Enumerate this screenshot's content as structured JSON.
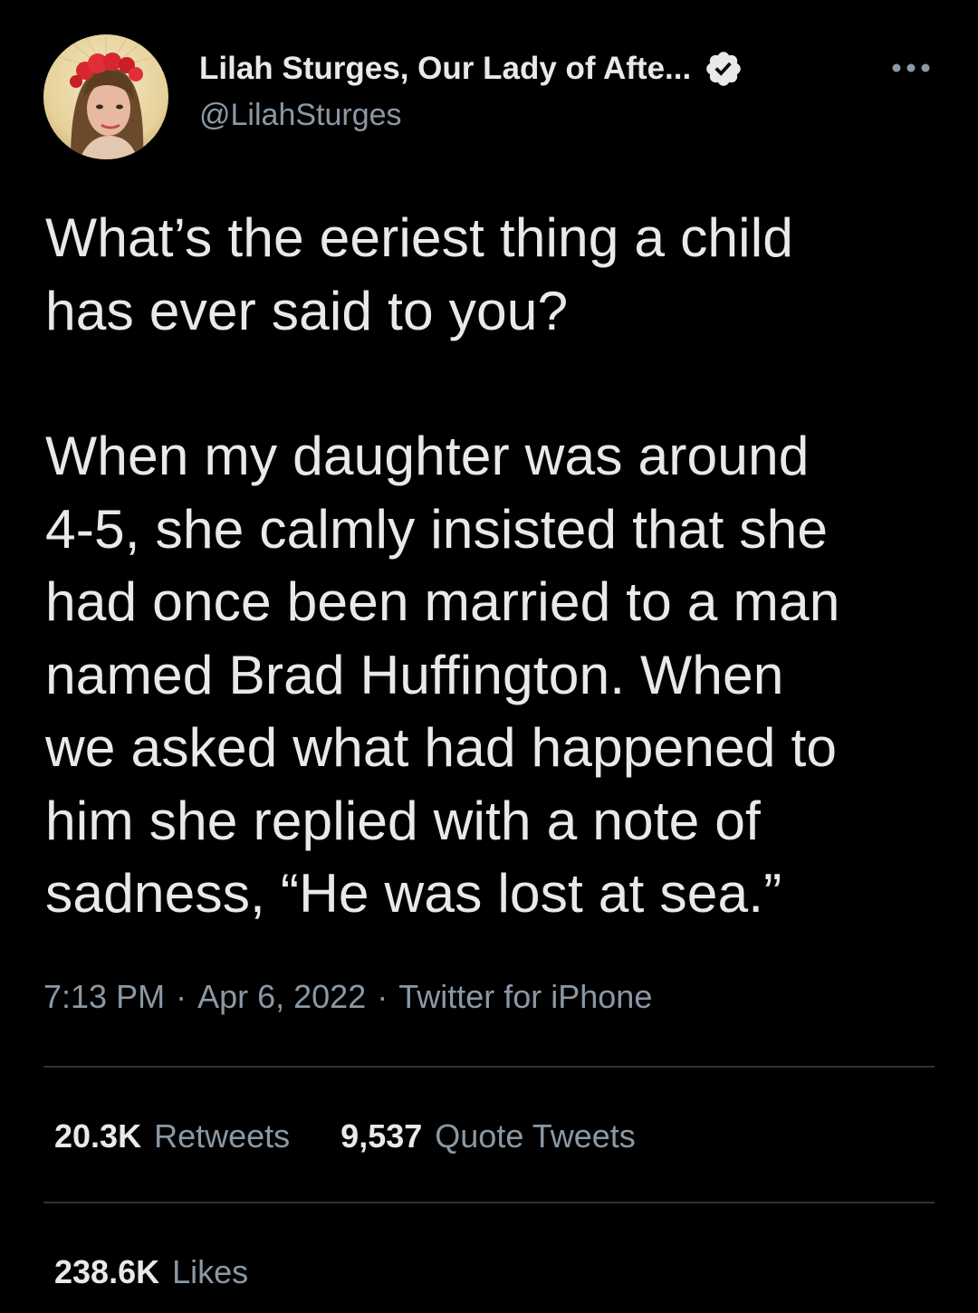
{
  "author": {
    "display_name": "Lilah Sturges, Our Lady of Afte...",
    "handle": "@LilahSturges",
    "verified": true
  },
  "tweet": {
    "lines_p1": [
      "What’s the eeriest thing a child",
      "has ever said to you?"
    ],
    "lines_p2": [
      "When my daughter was around",
      "4-5, she calmly insisted that she",
      "had once been married to a man",
      "named Brad Huffington. When",
      "we asked what had happened to",
      "him she replied with a note of",
      "sadness, “He was lost at sea.”"
    ]
  },
  "meta": {
    "time": "7:13 PM",
    "separator": "·",
    "date": "Apr 6, 2022",
    "source": "Twitter for iPhone"
  },
  "stats": {
    "retweets_count": "20.3K",
    "retweets_label": "Retweets",
    "quotes_count": "9,537",
    "quotes_label": "Quote Tweets",
    "likes_count": "238.6K",
    "likes_label": "Likes"
  },
  "icons": {
    "verified": "verified-badge-icon",
    "more": "more-options-icon"
  },
  "colors": {
    "background": "#000000",
    "text": "#e7e9ea",
    "secondary": "#8b98a5",
    "divider": "#2f3336"
  }
}
